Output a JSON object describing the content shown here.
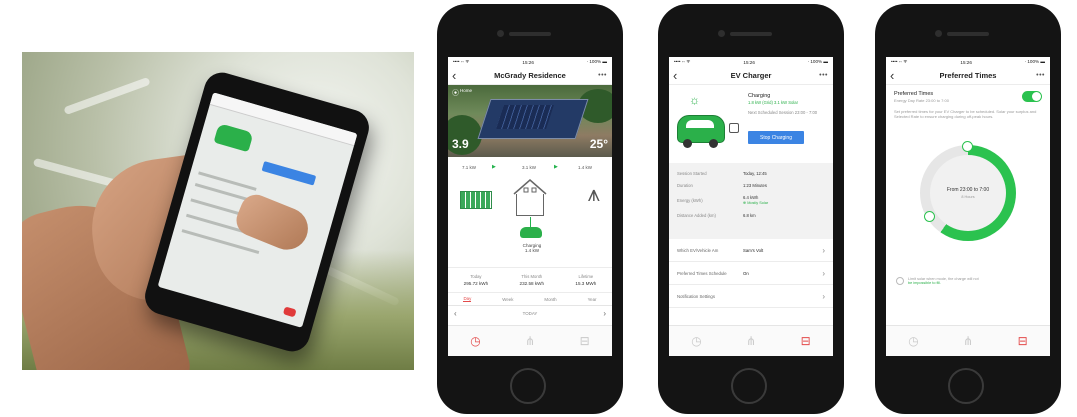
{
  "phone1": {
    "status_carrier": "•••• ◦◦ ᯤ",
    "status_time": "15:26",
    "status_battery": "⸱ 100% ▬",
    "title": "McGrady Residence",
    "hero_place": "Home",
    "hero_left_value": "3.9",
    "hero_right_value": "25°",
    "flow_left_label": "7.1 kW",
    "flow_mid_label": "3.1 kW",
    "flow_right_label": "1.4 kW",
    "charging_label": "Charging",
    "charging_sub": "1.4 kW",
    "stats": [
      {
        "label": "Today",
        "value": "295.72 kWh"
      },
      {
        "label": "This Month",
        "value": "232.58 kWh"
      },
      {
        "label": "Lifetime",
        "value": "15.3 MWh"
      }
    ],
    "tabs": [
      "Day",
      "Week",
      "Month",
      "Year"
    ],
    "pager_label": "TODAY"
  },
  "phone2": {
    "status_carrier": "•••• ◦◦ ᯤ",
    "status_time": "15:26",
    "status_battery": "⸱ 100% ▬",
    "title": "EV Charger",
    "state": "Charging",
    "state_sub": "1.8 kW (Grid) 3.1 kW Solar",
    "next_schedule": "Next Scheduled Session 23:00 - 7:00",
    "stop_button": "Stop Charging",
    "details": [
      {
        "k": "Session Started",
        "v": "Today, 12:45",
        "sub": ""
      },
      {
        "k": "Duration",
        "v": "1:23 Minutes",
        "sub": ""
      },
      {
        "k": "Energy (kWh)",
        "v": "6.4 kWh",
        "sub": "⊕ Mostly Solar"
      },
      {
        "k": "Distance Added (km)",
        "v": "6.8 km",
        "sub": ""
      }
    ],
    "settings": [
      {
        "k": "Which EV/Vehicle Am",
        "v": "Sam's Volt"
      },
      {
        "k": "Preferred Times Schedule",
        "v": "On"
      },
      {
        "k": "Notification Settings",
        "v": ""
      }
    ]
  },
  "phone3": {
    "status_carrier": "•••• ◦◦ ᯤ",
    "status_time": "15:26",
    "status_battery": "⸱ 100% ▬",
    "title": "Preferred Times",
    "toggle_title": "Preferred Times",
    "toggle_sub": "Energy Day Rate 23:00 to 7:00",
    "description": "Set preferred times for your EV Charger to be scheduled. Solar your surplus and Selected Rate to ensure charging during off-peak hours.",
    "dial_main": "From 23:00 to 7:00",
    "dial_sub": "8 Hours",
    "note": "Limit solar when mode, the charge will not",
    "note_link": "be impossible to fill."
  },
  "icons": {
    "timer": "◷",
    "network": "⋔",
    "car": "⊟"
  },
  "colors": {
    "accent_green": "#2bb04a",
    "accent_blue": "#3b84e3",
    "accent_red": "#e34b4b"
  }
}
